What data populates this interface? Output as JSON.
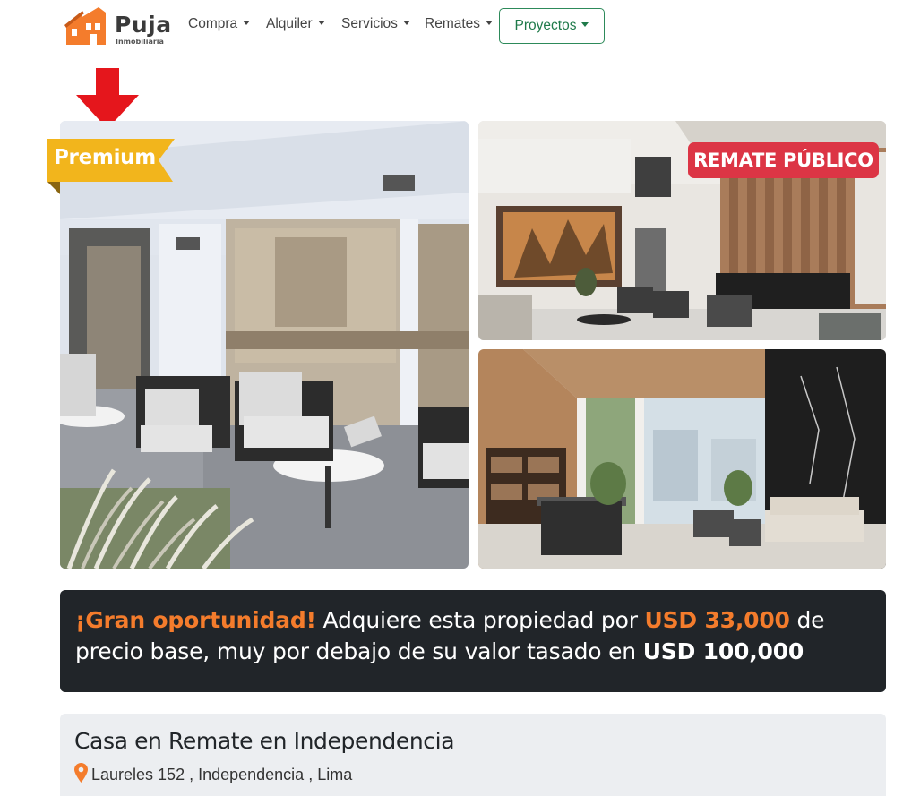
{
  "brand": {
    "name": "Puja",
    "subtitle": "Inmobiliaria"
  },
  "nav": {
    "items": [
      {
        "label": "Compra"
      },
      {
        "label": "Alquiler"
      },
      {
        "label": "Servicios"
      },
      {
        "label": "Remates"
      }
    ],
    "highlight": {
      "label": "Proyectos"
    }
  },
  "gallery": {
    "premium_badge": "Premium",
    "auction_badge": "REMATE PÚBLICO"
  },
  "promo": {
    "headline": "¡Gran oportunidad!",
    "text_1": " Adquiere esta propiedad por ",
    "price": "USD 33,000",
    "text_2": " de precio base, muy por debajo de su valor tasado en ",
    "appraised": "USD 100,000"
  },
  "listing": {
    "title": "Casa en Remate en Independencia",
    "address": "Laureles 152 , Independencia , Lima"
  },
  "colors": {
    "brand_orange": "#f47c2c",
    "premium_yellow": "#f2b51c",
    "auction_red": "#dc3545",
    "project_green": "#2d8a5a",
    "banner_dark": "#212529"
  }
}
